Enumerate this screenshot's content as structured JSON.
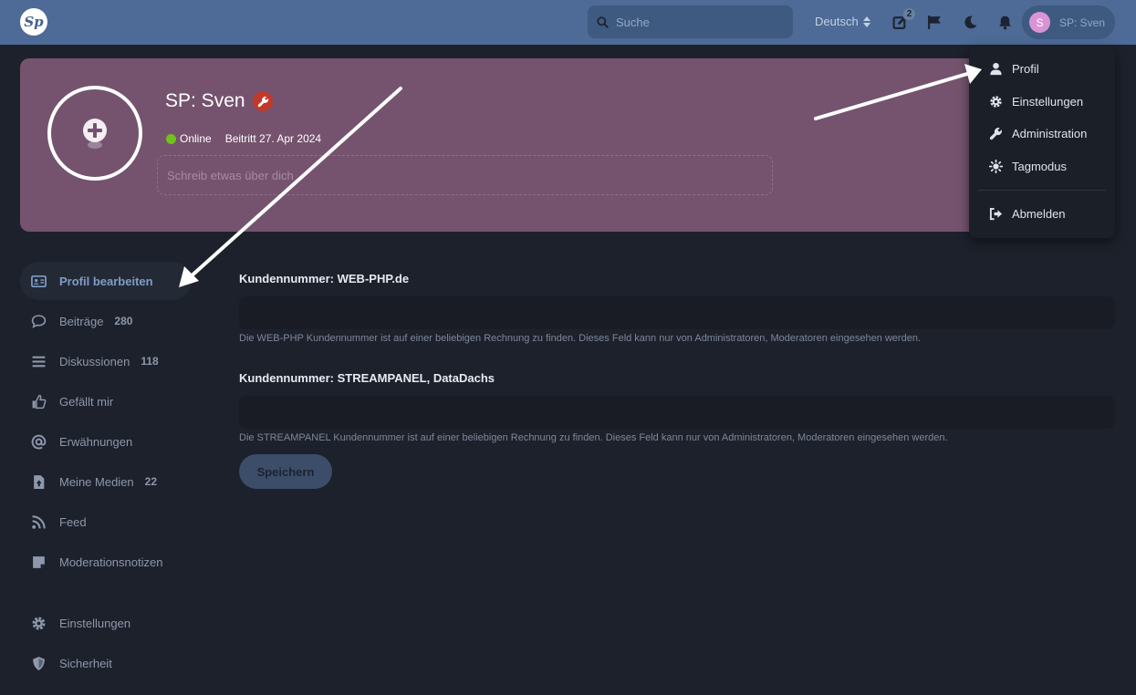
{
  "header": {
    "logo_text": "Sp",
    "search_placeholder": "Suche",
    "language": "Deutsch",
    "notification_badge": "2",
    "user_initial": "S",
    "user_name": "SP: Sven",
    "colors": {
      "bar": "#4d6b96",
      "avatar": "#d994d6"
    }
  },
  "profile": {
    "name": "SP: Sven",
    "status": "Online",
    "joined": "Beitritt 27. Apr 2024",
    "bio_placeholder": "Schreib etwas über dich",
    "colors": {
      "hero": "#75536e",
      "online": "#70c21a",
      "admin_badge": "#c0392b"
    }
  },
  "user_menu": {
    "items": [
      {
        "label": "Profil",
        "icon": "user-icon"
      },
      {
        "label": "Einstellungen",
        "icon": "gear-icon"
      },
      {
        "label": "Administration",
        "icon": "wrench-icon"
      },
      {
        "label": "Tagmodus",
        "icon": "sun-icon"
      },
      {
        "label": "Abmelden",
        "icon": "logout-icon"
      }
    ]
  },
  "sidebar": {
    "items": [
      {
        "label": "Profil bearbeiten",
        "count": "",
        "icon": "id-card-icon",
        "active": true
      },
      {
        "label": "Beiträge",
        "count": "280",
        "icon": "comment-icon"
      },
      {
        "label": "Diskussionen",
        "count": "118",
        "icon": "list-icon"
      },
      {
        "label": "Gefällt mir",
        "count": "",
        "icon": "thumbs-up-icon"
      },
      {
        "label": "Erwähnungen",
        "count": "",
        "icon": "at-icon"
      },
      {
        "label": "Meine Medien",
        "count": "22",
        "icon": "file-upload-icon"
      },
      {
        "label": "Feed",
        "count": "",
        "icon": "rss-icon"
      },
      {
        "label": "Moderationsnotizen",
        "count": "",
        "icon": "sticky-note-icon"
      },
      {
        "label": "Einstellungen",
        "count": "",
        "icon": "gear-icon"
      },
      {
        "label": "Sicherheit",
        "count": "",
        "icon": "shield-icon"
      }
    ]
  },
  "form": {
    "fields": [
      {
        "label": "Kundennummer: WEB-PHP.de",
        "value": "",
        "help": "Die WEB-PHP Kundennummer ist auf einer beliebigen Rechnung zu finden. Dieses Feld kann nur von Administratoren, Moderatoren eingesehen werden."
      },
      {
        "label": "Kundennummer: STREAMPANEL, DataDachs",
        "value": "",
        "help": "Die STREAMPANEL Kundennummer ist auf einer beliebigen Rechnung zu finden. Dieses Feld kann nur von Administratoren, Moderatoren eingesehen werden."
      }
    ],
    "save_label": "Speichern"
  }
}
